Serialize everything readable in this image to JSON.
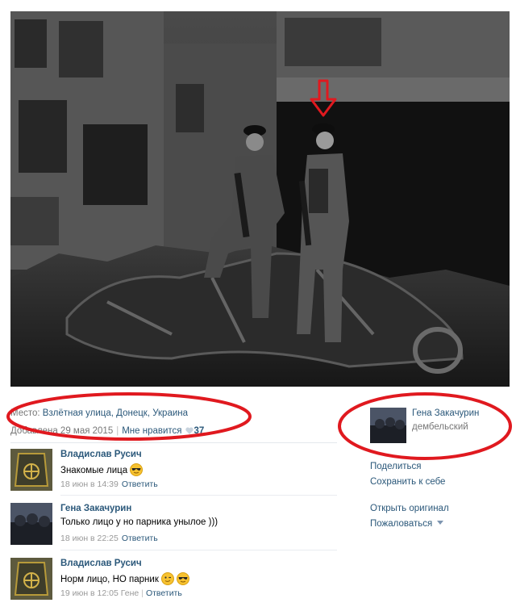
{
  "photo": {
    "alt": ""
  },
  "meta": {
    "place_label": "Место:",
    "place_value": "Взлётная улица, Донецк, Украина",
    "added": "Добавлена 29 мая 2015",
    "like_label": "Мне нравится",
    "likes": "37"
  },
  "owner": {
    "name": "Гена Закачурин",
    "status": "дембельский"
  },
  "actions": {
    "share": "Поделиться",
    "save": "Сохранить к себе",
    "open_original": "Открыть оригинал",
    "report": "Пожаловаться"
  },
  "comments": [
    {
      "author": "Владислав Русич",
      "text": "Знакомые лица",
      "emoji": "sunglasses",
      "time": "18 июн в 14:39",
      "reply": "Ответить"
    },
    {
      "author": "Гена Закачурин",
      "text": "Только лицо у но парника унылое )))",
      "time": "18 июн в 22:25",
      "reply": "Ответить"
    },
    {
      "author": "Владислав Русич",
      "text": "Норм лицо, НО парник",
      "emoji": [
        "wink",
        "sunglasses"
      ],
      "time": "19 июн в 12:05",
      "to": "Гене",
      "reply": "Ответить"
    }
  ],
  "colors": {
    "link": "#2b587a",
    "annotation": "#e0191f",
    "muted": "#777777"
  }
}
